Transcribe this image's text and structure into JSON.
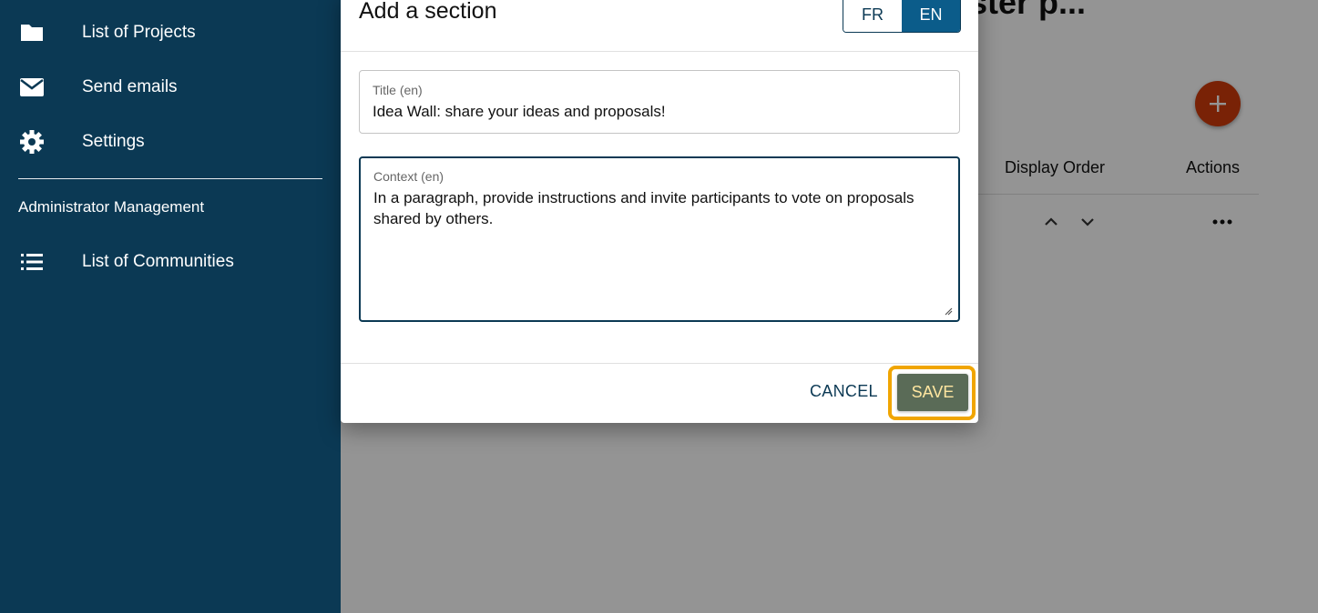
{
  "sidebar": {
    "items": [
      {
        "label": "List of Projects",
        "icon": "folder-icon"
      },
      {
        "label": "Send emails",
        "icon": "mail-icon"
      },
      {
        "label": "Settings",
        "icon": "gear-icon"
      }
    ],
    "section_title": "Administrator Management",
    "admin_items": [
      {
        "label": "List of Communities",
        "icon": "list-icon"
      }
    ]
  },
  "main": {
    "page_title": "ster p...",
    "columns": [
      "Display Order",
      "Actions"
    ]
  },
  "dialog": {
    "title": "Add a section",
    "languages": [
      "FR",
      "EN"
    ],
    "selected_language": "EN",
    "title_field": {
      "label": "Title (en)",
      "value": "Idea Wall: share your ideas and proposals!"
    },
    "context_field": {
      "label": "Context (en)",
      "value": "In a paragraph, provide instructions and invite participants to vote on proposals shared by others."
    },
    "cancel_label": "CANCEL",
    "save_label": "SAVE"
  },
  "colors": {
    "sidebar": "#0b3954",
    "accent": "#0b5c8a",
    "fab": "#d03c0c",
    "save_button": "#5a6b57",
    "focus_outline": "#f0a500"
  }
}
